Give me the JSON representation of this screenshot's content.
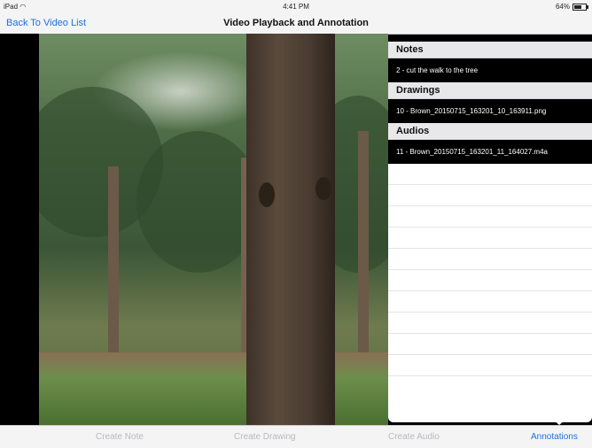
{
  "status_bar": {
    "device": "iPad",
    "wifi": "wifi-icon",
    "time": "4:41 PM",
    "battery_percent": "64%"
  },
  "nav": {
    "back_label": "Back To Video List",
    "title": "Video Playback and Annotation"
  },
  "panel": {
    "sections": [
      {
        "header": "Notes",
        "items": [
          "2 - cut the walk to the tree"
        ]
      },
      {
        "header": "Drawings",
        "items": [
          "10 - Brown_20150715_163201_10_163911.png"
        ]
      },
      {
        "header": "Audios",
        "items": [
          "11 - Brown_20150715_163201_11_164027.m4a"
        ]
      }
    ]
  },
  "toolbar": {
    "create_note": "Create Note",
    "create_drawing": "Create Drawing",
    "create_audio": "Create Audio",
    "annotations": "Annotations"
  },
  "colors": {
    "accent": "#1e6fe2",
    "disabled": "#b9b9bd",
    "selected_row": "#000000"
  }
}
